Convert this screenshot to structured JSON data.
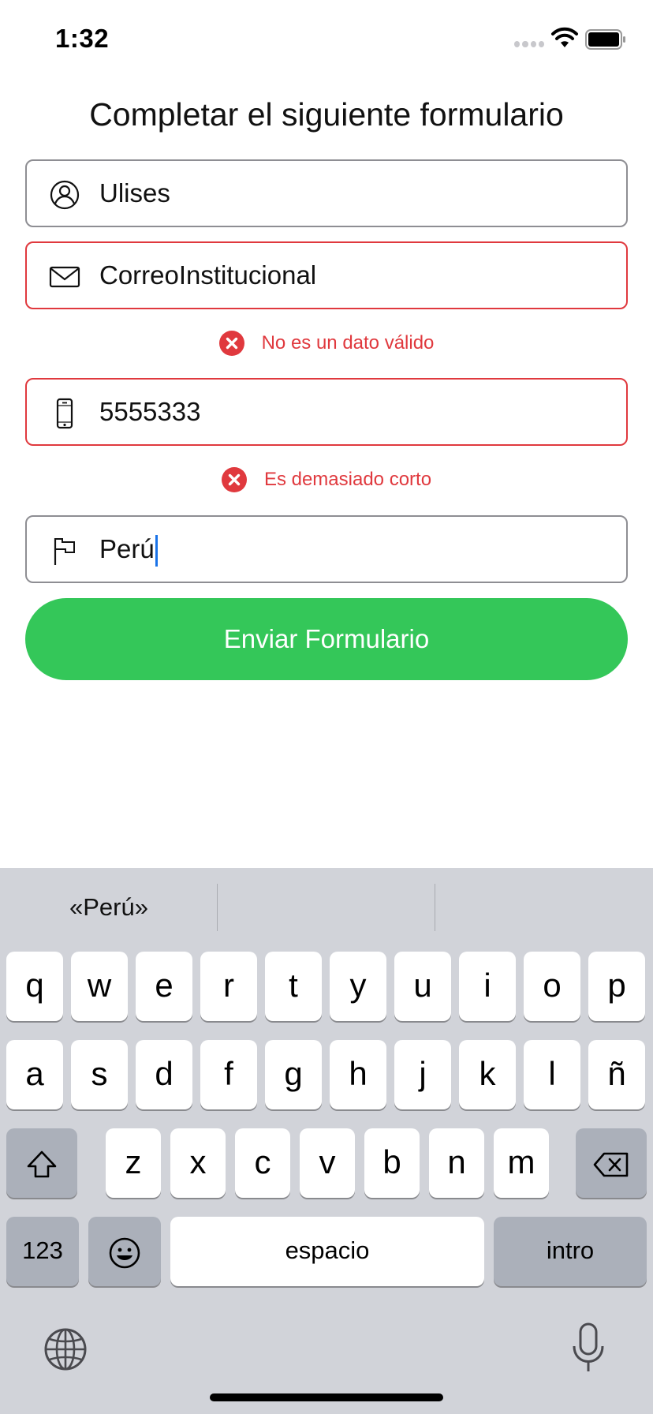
{
  "status_bar": {
    "time": "1:32"
  },
  "form": {
    "title": "Completar el siguiente formulario",
    "fields": [
      {
        "icon": "user-icon",
        "value": "Ulises",
        "error": false
      },
      {
        "icon": "mail-icon",
        "value": "CorreoInstitucional",
        "error": true,
        "error_text": "No es un dato válido"
      },
      {
        "icon": "phone-icon",
        "value": "5555333",
        "error": true,
        "error_text": "Es demasiado corto"
      },
      {
        "icon": "flag-icon",
        "value": "Perú",
        "error": false,
        "focused": true
      }
    ],
    "submit_label": "Enviar Formulario"
  },
  "colors": {
    "accent_green": "#34c759",
    "error_red": "#e0393e",
    "caret_blue": "#1a73e8"
  },
  "keyboard": {
    "suggestions": [
      "«Perú»",
      "",
      ""
    ],
    "row1": [
      "q",
      "w",
      "e",
      "r",
      "t",
      "y",
      "u",
      "i",
      "o",
      "p"
    ],
    "row2": [
      "a",
      "s",
      "d",
      "f",
      "g",
      "h",
      "j",
      "k",
      "l",
      "ñ"
    ],
    "row3": [
      "z",
      "x",
      "c",
      "v",
      "b",
      "n",
      "m"
    ],
    "numbers_label": "123",
    "space_label": "espacio",
    "return_label": "intro"
  }
}
